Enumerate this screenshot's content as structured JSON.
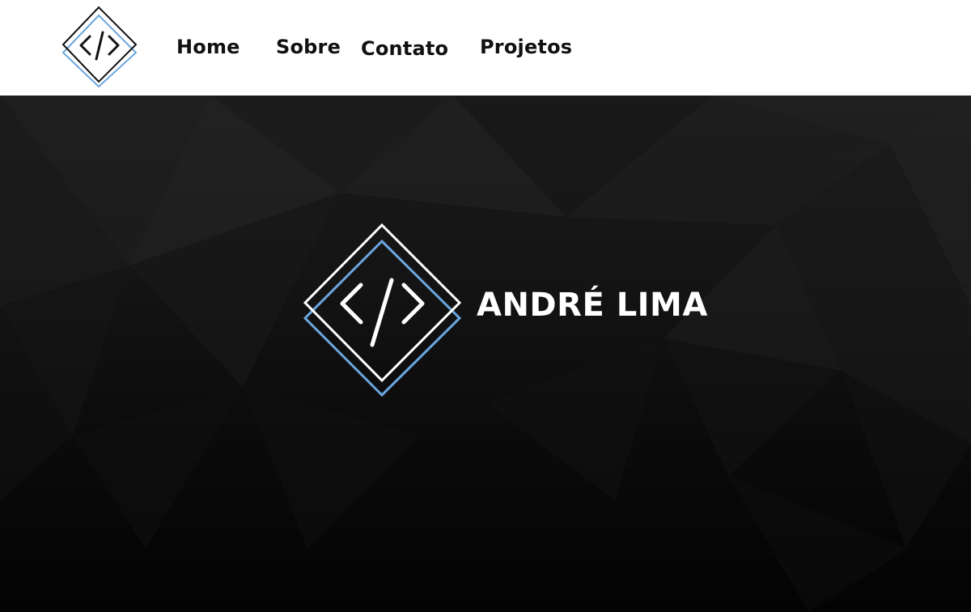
{
  "nav": {
    "logo_icon": "code-brackets-diamond-logo",
    "links": [
      "Home",
      "Sobre",
      "Contato",
      "Projetos"
    ]
  },
  "hero": {
    "logo_icon": "code-brackets-diamond-logo",
    "title": "ANDRÉ LIMA"
  },
  "colors": {
    "nav_background": "#ffffff",
    "nav_text": "#111111",
    "accent_blue": "#6aa6e0",
    "hero_background": "#0b0b0b",
    "hero_text": "#ffffff"
  }
}
